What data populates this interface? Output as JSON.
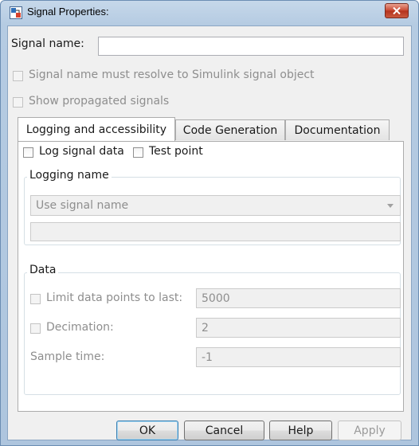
{
  "window": {
    "title": "Signal Properties:"
  },
  "signal_name": {
    "label": "Signal name:",
    "value": ""
  },
  "options": {
    "resolve_label": "Signal name must resolve to Simulink signal object",
    "resolve_checked": false,
    "show_propagated_label": "Show propagated signals",
    "show_propagated_checked": false
  },
  "tabs": [
    {
      "label": "Logging and accessibility",
      "active": true
    },
    {
      "label": "Code Generation",
      "active": false
    },
    {
      "label": "Documentation",
      "active": false
    }
  ],
  "logging": {
    "log_signal_label": "Log signal data",
    "log_signal_checked": false,
    "test_point_label": "Test point",
    "test_point_checked": false,
    "logging_name_group": "Logging name",
    "logging_name_option": "Use signal name",
    "logging_name_value": ""
  },
  "data_group": {
    "title": "Data",
    "limit_label": "Limit data points to last:",
    "limit_checked": false,
    "limit_value": "5000",
    "decimation_label": "Decimation:",
    "decimation_checked": false,
    "decimation_value": "2",
    "sample_time_label": "Sample time:",
    "sample_time_value": "-1"
  },
  "buttons": {
    "ok": "OK",
    "cancel": "Cancel",
    "help": "Help",
    "apply": "Apply"
  },
  "colors": {
    "title_bar": "#b5cbe2",
    "close_button": "#c7452f",
    "dialog_bg": "#f0f0f0",
    "disabled_text": "#8e8e8e"
  }
}
